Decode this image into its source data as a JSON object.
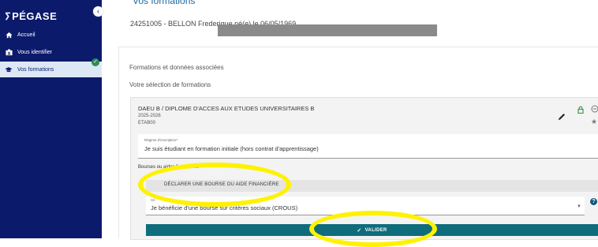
{
  "sidebar": {
    "brand": "PÉGASE",
    "items": [
      {
        "label": "Accueil",
        "icon": "home-icon"
      },
      {
        "label": "Vous identifier",
        "icon": "id-card-icon"
      },
      {
        "label": "Vos formations",
        "icon": "graduation-cap-icon"
      }
    ]
  },
  "header": {
    "title": "Vos formations",
    "student_line": "24251005 - BELLON Frederique né(e) le 06/05/1969"
  },
  "main": {
    "section_title": "Formations et données associées",
    "selection_title": "Votre sélection de formations",
    "formation": {
      "name": "DAEU B / DIPLOME D'ACCES AUX ETUDES UNIVERSITAIRES B",
      "year": "2025-2026",
      "etab": "ETAB00"
    },
    "regime": {
      "label": "Régime d'inscription*",
      "value": "Je suis étudiant en formation initiale (hors contrat d'apprentissage)"
    },
    "bourses_label": "Bourses ou aides financières",
    "declare_label": "DÉCLARER UNE BOURSE OU AIDE FINANCIÈRE",
    "bourse_select": {
      "label": "Sé",
      "value": "Je bénéficie d'une bourse sur critères sociaux (CROUS)"
    },
    "valider_label": "VALIDER"
  },
  "colors": {
    "sidebar": "#0c1a6b",
    "active": "#dde8f6",
    "primary": "#0f6c7c",
    "annotation": "#fff200"
  }
}
